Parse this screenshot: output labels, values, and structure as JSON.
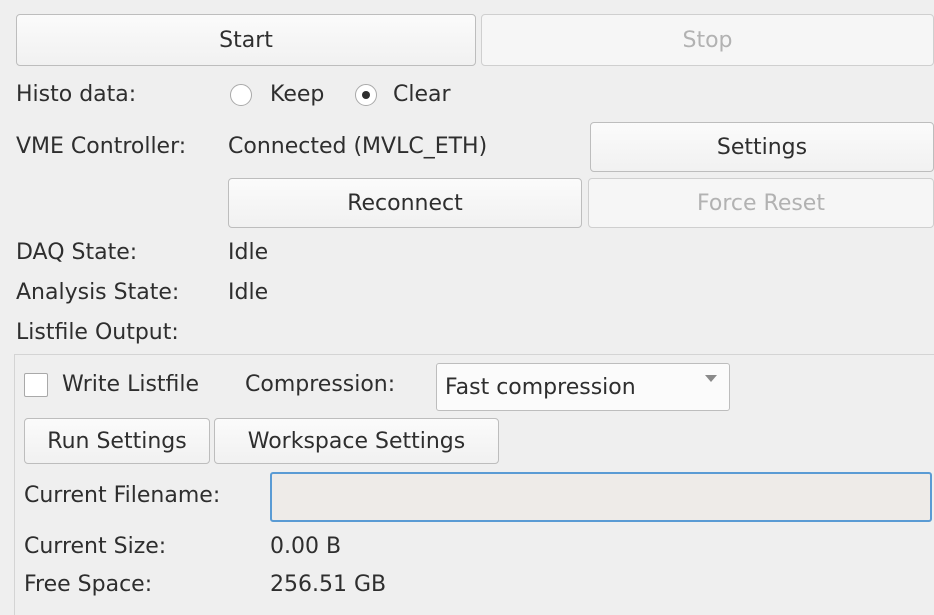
{
  "controls": {
    "start_label": "Start",
    "stop_label": "Stop"
  },
  "histo": {
    "label": "Histo data:",
    "options": [
      {
        "label": "Keep",
        "selected": false
      },
      {
        "label": "Clear",
        "selected": true
      }
    ]
  },
  "vme": {
    "label": "VME Controller:",
    "status": "Connected (MVLC_ETH)",
    "settings_label": "Settings",
    "reconnect_label": "Reconnect",
    "force_reset_label": "Force Reset"
  },
  "daq_state": {
    "label": "DAQ State:",
    "value": "Idle"
  },
  "analysis_state": {
    "label": "Analysis State:",
    "value": "Idle"
  },
  "listfile": {
    "section_label": "Listfile Output:",
    "write_label": "Write Listfile",
    "write_checked": false,
    "compression_label": "Compression:",
    "compression_value": "Fast compression",
    "run_settings_label": "Run Settings",
    "workspace_settings_label": "Workspace Settings",
    "filename_label": "Current Filename:",
    "filename_value": "",
    "size_label": "Current Size:",
    "size_value": "0.00 B",
    "free_label": "Free Space:",
    "free_value": "256.51 GB"
  },
  "colors": {
    "focus": "#5a9bd4",
    "disabled_text": "#b2b2b2"
  }
}
